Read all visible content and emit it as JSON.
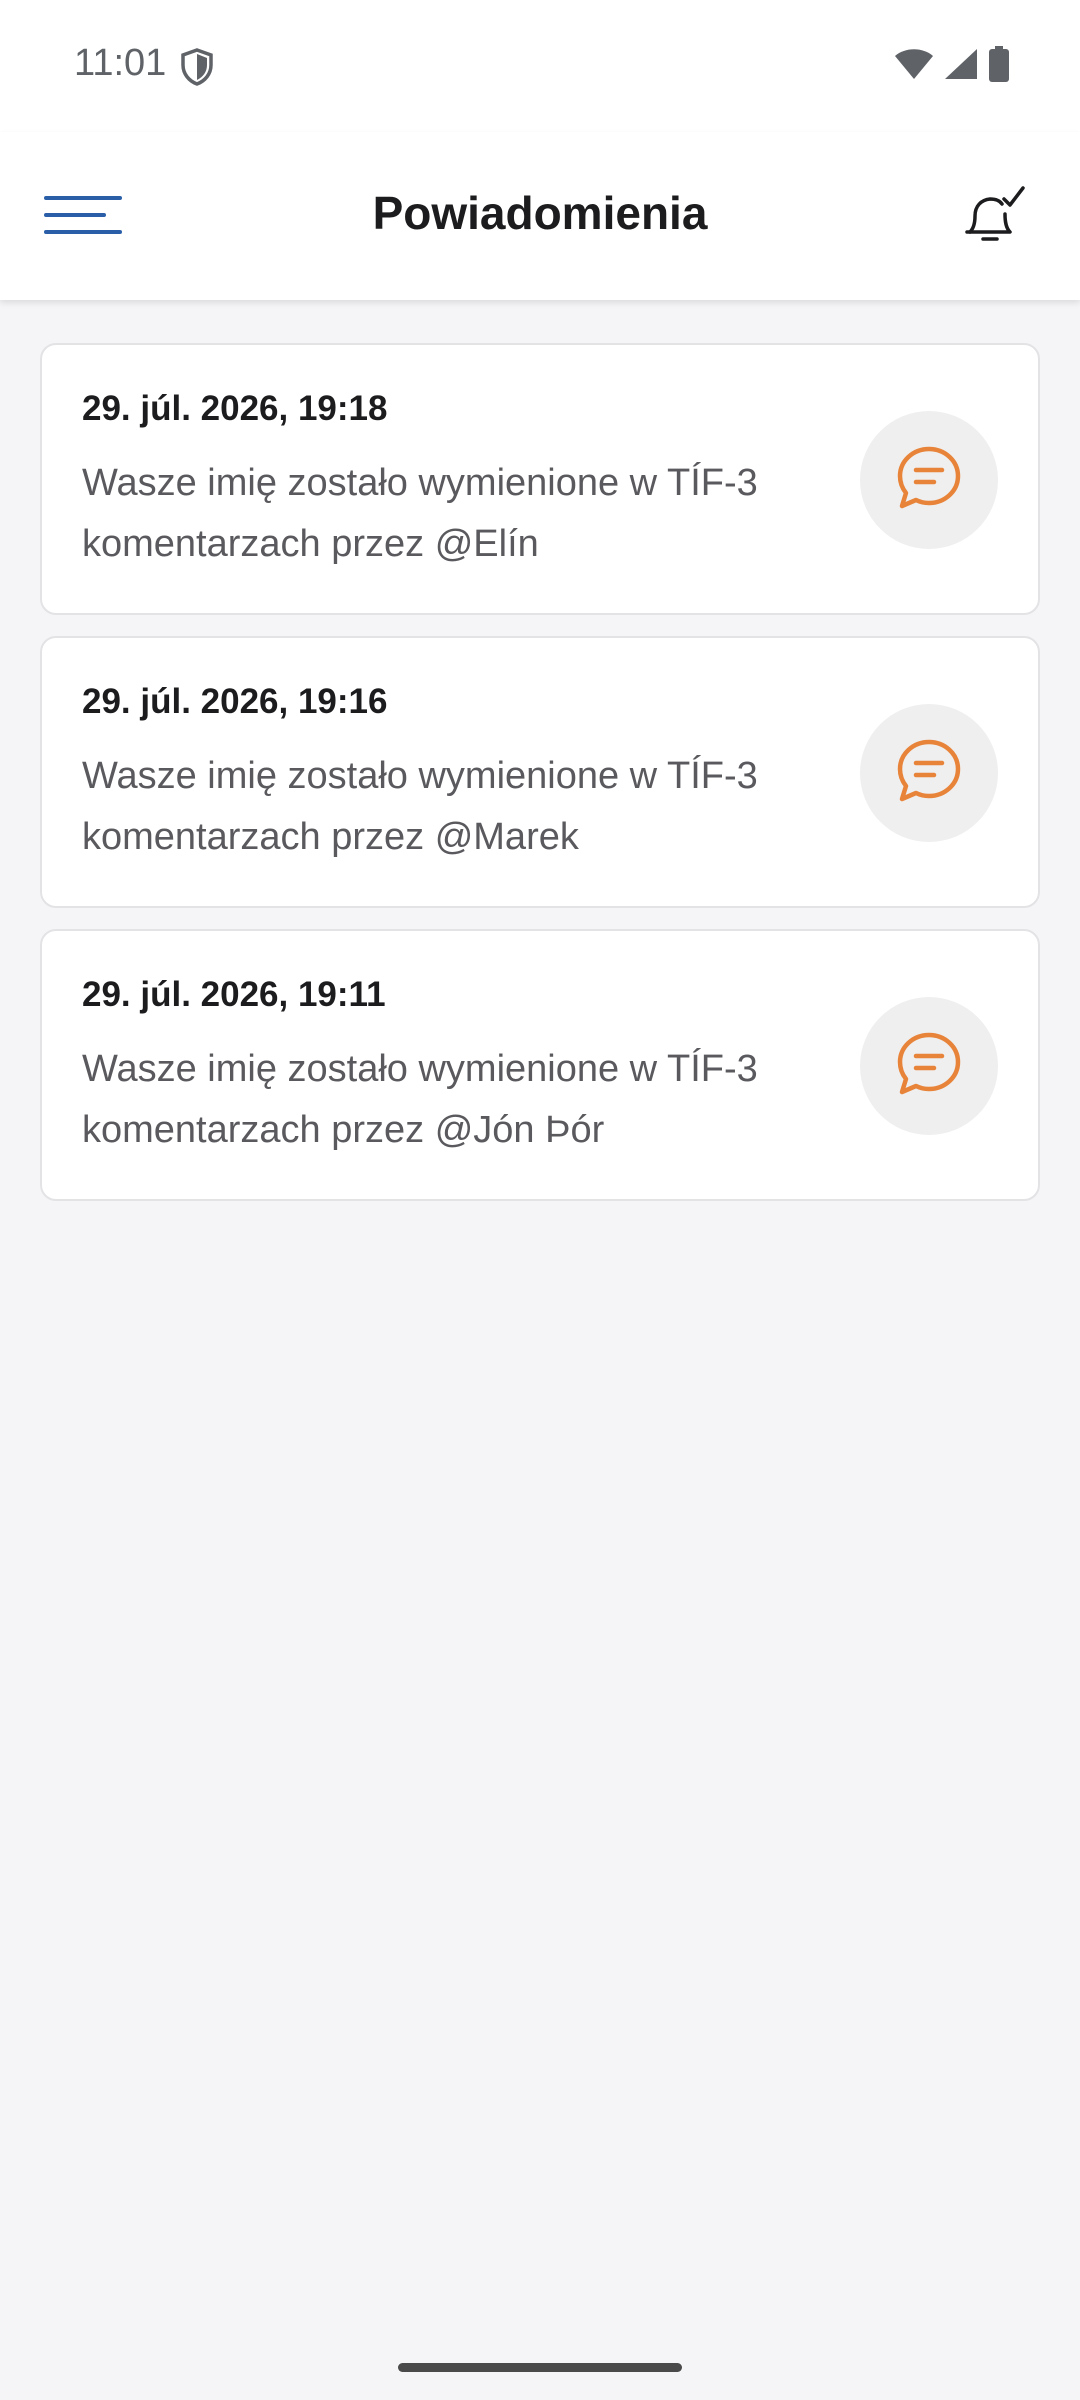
{
  "status_bar": {
    "time": "11:01",
    "icons": [
      "shield-icon",
      "wifi-icon",
      "signal-icon",
      "battery-icon"
    ]
  },
  "header": {
    "title": "Powiadomienia",
    "menu_icon": "hamburger-menu-icon",
    "action_icon": "bell-check-icon"
  },
  "colors": {
    "accent_blue": "#2a5fa8",
    "icon_orange": "#e8843a",
    "icon_bg": "#efefef",
    "background": "#f5f5f7"
  },
  "notifications": [
    {
      "date": "29. júl. 2026, 19:18",
      "message": "Wasze imię zostało wymienione w TÍF-3 komentarzach przez @Elín",
      "icon": "chat-bubble-icon"
    },
    {
      "date": "29. júl. 2026, 19:16",
      "message": "Wasze imię zostało wymienione w TÍF-3 komentarzach przez @Marek",
      "icon": "chat-bubble-icon"
    },
    {
      "date": "29. júl. 2026, 19:11",
      "message": "Wasze imię zostało wymienione w TÍF-3 komentarzach przez @Jón Þór",
      "icon": "chat-bubble-icon"
    }
  ]
}
